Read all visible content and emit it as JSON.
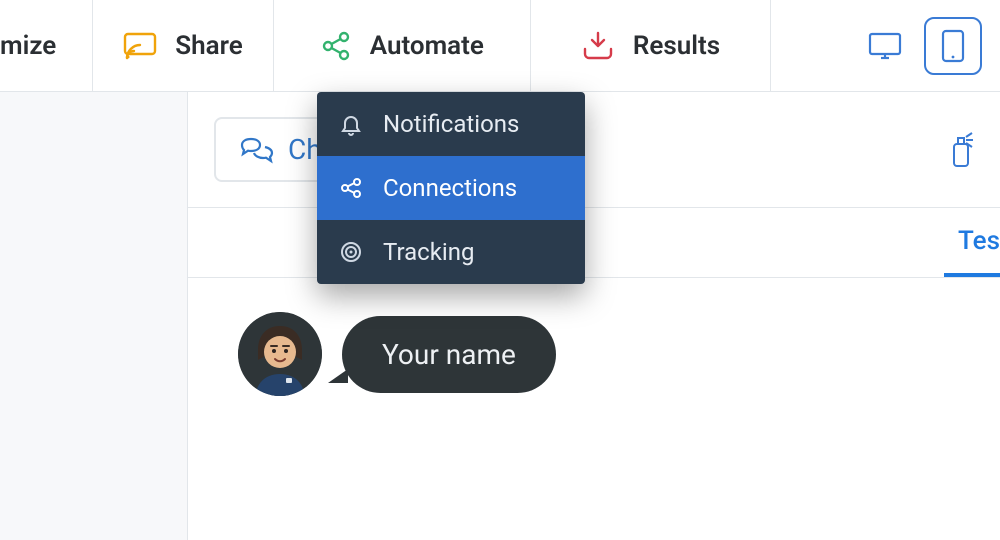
{
  "topbar": {
    "customize_label": "mize",
    "share_label": "Share",
    "automate_label": "Automate",
    "results_label": "Results"
  },
  "dropdown": {
    "items": [
      {
        "label": "Notifications"
      },
      {
        "label": "Connections"
      },
      {
        "label": "Tracking"
      }
    ]
  },
  "toolrow": {
    "chat_label": "Chat"
  },
  "tabs": {
    "right_partial": "Tes"
  },
  "chat": {
    "bubble_text": "Your name"
  }
}
